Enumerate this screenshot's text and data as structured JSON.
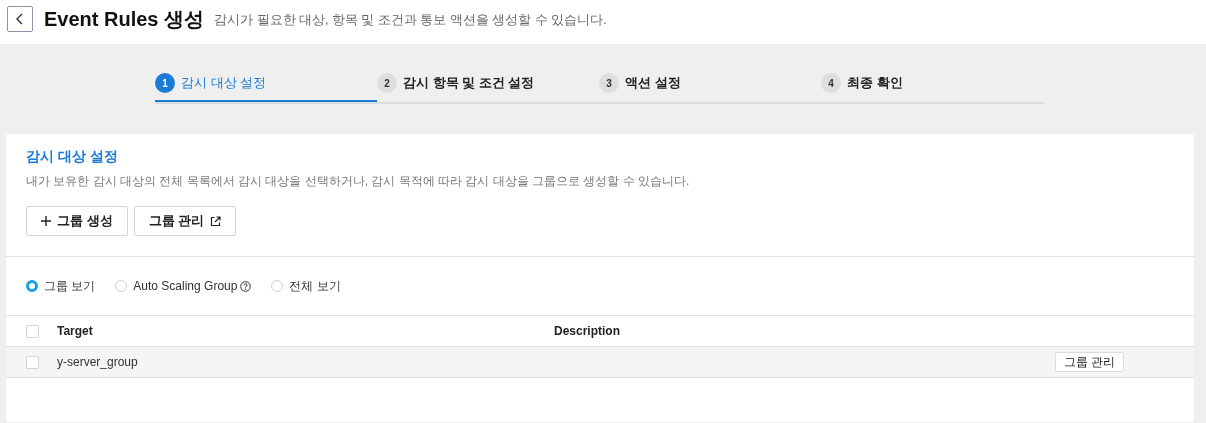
{
  "header": {
    "title": "Event Rules 생성",
    "subtitle": "감시가 필요한 대상, 항목 및 조건과 통보 액션을 생성할 수 있습니다."
  },
  "steps": [
    {
      "number": "1",
      "label": "감시 대상 설정",
      "selected": true
    },
    {
      "number": "2",
      "label": "감시 항목 및 조건 설정",
      "selected": false
    },
    {
      "number": "3",
      "label": "액션 설정",
      "selected": false
    },
    {
      "number": "4",
      "label": "최종 확인",
      "selected": false
    }
  ],
  "panel": {
    "title": "감시 대상 설정",
    "description": "내가 보유한 감시 대상의 전체 목록에서 감시 대상을 선택하거나, 감시 목적에 따라 감시 대상을 그룹으로 생성할 수 있습니다.",
    "buttons": [
      {
        "kind": "add",
        "label": "그룹 생성"
      },
      {
        "kind": "external",
        "label": "그룹 관리"
      }
    ],
    "view_options": [
      {
        "label": "그룹 보기",
        "selected": true,
        "help": false
      },
      {
        "label": "Auto Scaling Group",
        "selected": false,
        "help": true
      },
      {
        "label": "전체 보기",
        "selected": false,
        "help": false
      }
    ],
    "table": {
      "select_all_checked": false,
      "columns": [
        "Target",
        "Description"
      ],
      "rows": [
        {
          "checked": false,
          "target": "y-server_group",
          "action": "그룹 관리"
        }
      ]
    }
  }
}
